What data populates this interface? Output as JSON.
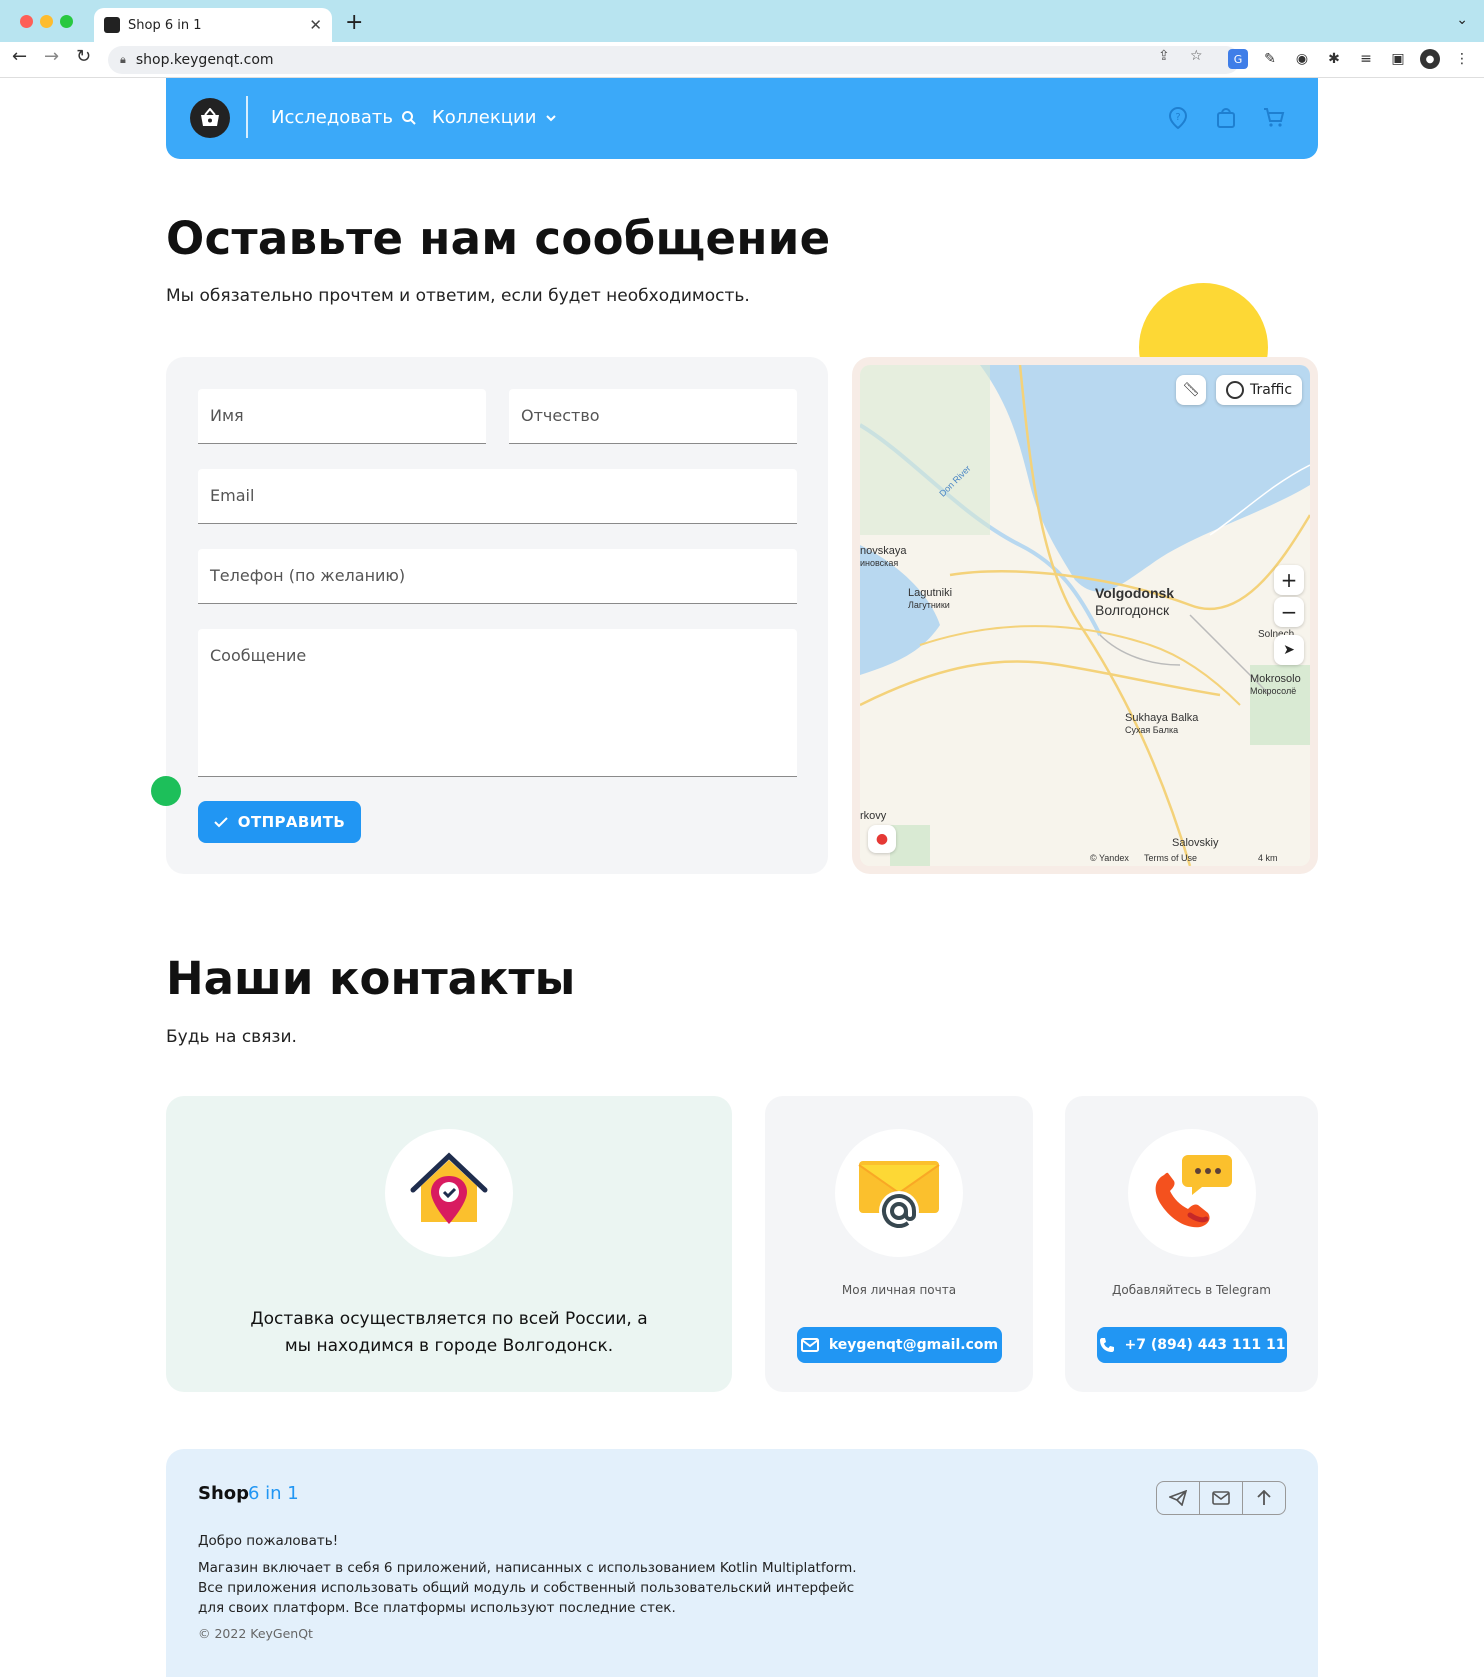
{
  "browser": {
    "tab_title": "Shop 6 in 1",
    "url": "shop.keygenqt.com"
  },
  "header": {
    "explore_label": "Исследовать",
    "collections_label": "Коллекции"
  },
  "message_section": {
    "title": "Оставьте нам сообщение",
    "subtitle": "Мы обязательно прочтем и ответим, если будет необходимость.",
    "fields": {
      "name": "Имя",
      "patronymic": "Отчество",
      "email": "Email",
      "phone": "Телефон (по желанию)",
      "message": "Сообщение"
    },
    "send_label": "ОТПРАВИТЬ"
  },
  "map": {
    "traffic_label": "Traffic",
    "city_en": "Volgodonsk",
    "city_ru": "Волгодонск",
    "place_lagutniki_en": "Lagutniki",
    "place_lagutniki_ru": "Лагутники",
    "place_sukhaya_en": "Sukhaya Balka",
    "place_sukhaya_ru": "Сухая Балка",
    "place_novskaya_en": "novskaya",
    "place_novskaya_ru": "иновская",
    "place_mokrosol_en": "Mokrosolo",
    "place_mokrosol_ru": "Мокросолё",
    "place_solnech": "Solnech",
    "place_salovskiy": "Salovskiy",
    "place_rkovy": "rkovy",
    "river_label": "Don River",
    "copyright": "© Yandex",
    "terms": "Terms of Use",
    "scale": "4 km"
  },
  "contacts_section": {
    "title": "Наши контакты",
    "subtitle": "Будь на связи.",
    "address_text": "Доставка осуществляется по всей России, а мы находимся в городе Волгодонск.",
    "email_label": "Моя личная почта",
    "email_value": "keygenqt@gmail.com",
    "telegram_label": "Добавляйтесь в Telegram",
    "phone_value": "+7 (894) 443 111 11"
  },
  "footer": {
    "brand": "Shop",
    "brand_suffix": "6 in 1",
    "welcome": "Добро пожаловать!",
    "description_1": "Магазин включает в себя 6 приложений, написанных с использованием Kotlin Multiplatform.",
    "description_2": "Все приложения использовать общий модуль и собственный пользовательский интерфейс",
    "description_3": "для своих платформ. Все платформы используют последние стек.",
    "copyright": "© 2022 KeyGenQt"
  },
  "colors": {
    "header_blue": "#3ba9f9",
    "button_blue": "#2196f3",
    "accent_yellow": "#fdd835",
    "accent_green": "#1dbf5a"
  }
}
